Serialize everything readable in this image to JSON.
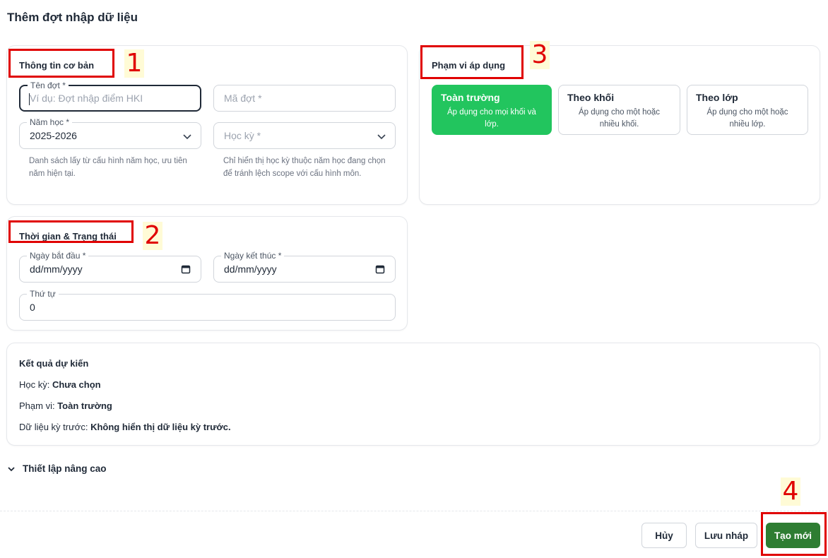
{
  "page": {
    "title": "Thêm đợt nhập dữ liệu"
  },
  "basic_info": {
    "title": "Thông tin cơ bản",
    "name_field": {
      "label": "Tên đợt *",
      "placeholder": "Ví dụ: Đợt nhập điểm HKI"
    },
    "code_field": {
      "placeholder": "Mã đợt *"
    },
    "year_field": {
      "label": "Năm học *",
      "value": "2025-2026",
      "helper": "Danh sách lấy từ cấu hình năm học, ưu tiên năm hiện tại."
    },
    "semester_field": {
      "placeholder": "Học kỳ *",
      "helper": "Chỉ hiển thị học kỳ thuộc năm học đang chọn để tránh lệch scope với cấu hình môn."
    }
  },
  "time_status": {
    "title": "Thời gian & Trạng thái",
    "start_field": {
      "label": "Ngày bắt đầu *",
      "value": "dd/mm/yyyy"
    },
    "end_field": {
      "label": "Ngày kết thúc *",
      "value": "dd/mm/yyyy"
    },
    "order_field": {
      "label": "Thứ tự",
      "value": "0"
    }
  },
  "scope": {
    "title": "Phạm vi áp dụng",
    "options": [
      {
        "title": "Toàn trường",
        "desc": "Áp dụng cho mọi khối và lớp.",
        "selected": true
      },
      {
        "title": "Theo khối",
        "desc": "Áp dụng cho một hoặc nhiều khối.",
        "selected": false
      },
      {
        "title": "Theo lớp",
        "desc": "Áp dụng cho một hoặc nhiều lớp.",
        "selected": false
      }
    ]
  },
  "result": {
    "title": "Kết quả dự kiến",
    "semester_label": "Học kỳ:",
    "semester_value": "Chưa chọn",
    "scope_label": "Phạm vi:",
    "scope_value": "Toàn trường",
    "prev_label": "Dữ liệu kỳ trước:",
    "prev_value": "Không hiển thị dữ liệu kỳ trước."
  },
  "advanced": {
    "label": "Thiết lập nâng cao"
  },
  "footer": {
    "cancel_label": "Hủy",
    "draft_label": "Lưu nháp",
    "create_label": "Tạo mới"
  },
  "annotations": {
    "n1": "1",
    "n2": "2",
    "n3": "3",
    "n4": "4"
  },
  "colors": {
    "accent_green": "#22c55e",
    "primary_green": "#2e7d32",
    "annotation_red": "#e00000"
  }
}
